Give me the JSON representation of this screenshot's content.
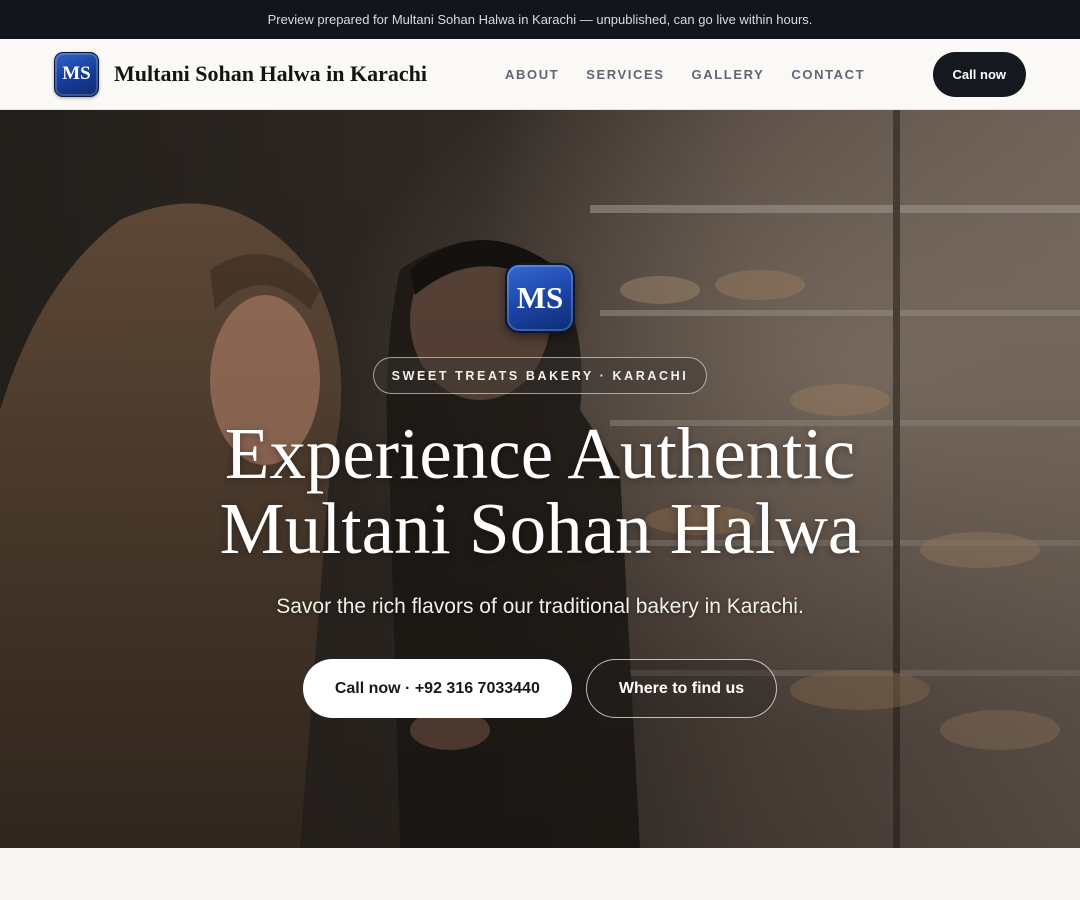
{
  "banner": {
    "text": "Preview prepared for Multani Sohan Halwa in Karachi — unpublished, can go live within hours."
  },
  "nav": {
    "logo_text": "MS",
    "brand_name": "Multani Sohan Halwa in Karachi",
    "links": [
      {
        "label": "ABOUT"
      },
      {
        "label": "SERVICES"
      },
      {
        "label": "GALLERY"
      },
      {
        "label": "CONTACT"
      }
    ],
    "cta_label": "Call now"
  },
  "hero": {
    "logo_text": "MS",
    "tagline": "SWEET TREATS BAKERY · KARACHI",
    "title_line1": "Experience Authentic",
    "title_line2": "Multani Sohan Halwa",
    "subtitle": "Savor the rich flavors of our traditional bakery in Karachi.",
    "primary_button": "Call now · +92 316 7033440",
    "secondary_button": "Where to find us",
    "background_image": "bakery-display-photo"
  },
  "colors": {
    "banner_bg": "#12151b",
    "nav_bg": "#faf9f6",
    "accent_dark": "#15181e",
    "logo_blue": "#1a43a3"
  }
}
